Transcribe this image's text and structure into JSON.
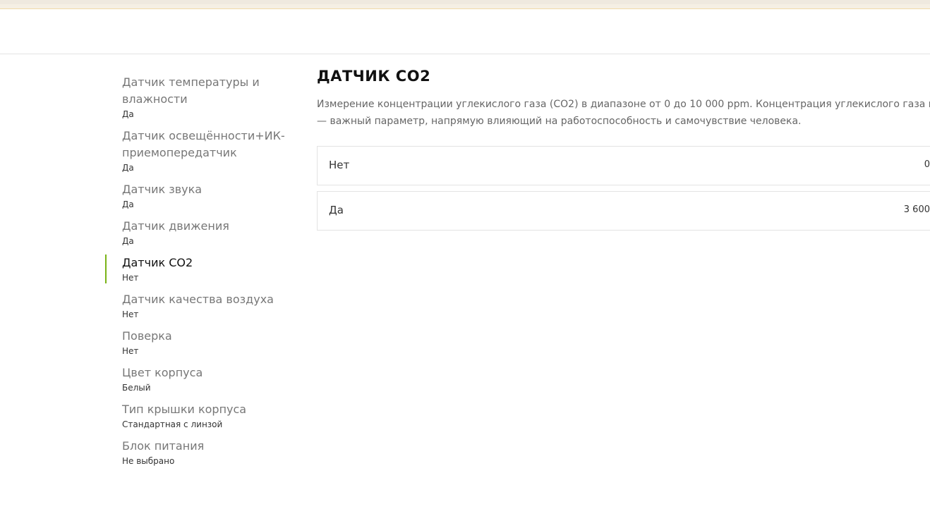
{
  "sidebar": {
    "items": [
      {
        "label": "Датчик температуры и влажности",
        "value": "Да"
      },
      {
        "label": "Датчик освещённости+ИК-приемопередатчик",
        "value": "Да"
      },
      {
        "label": "Датчик звука",
        "value": "Да"
      },
      {
        "label": "Датчик движения",
        "value": "Да"
      },
      {
        "label": "Датчик CO2",
        "value": "Нет",
        "active": true
      },
      {
        "label": "Датчик качества воздуха",
        "value": "Нет"
      },
      {
        "label": "Поверка",
        "value": "Нет"
      },
      {
        "label": "Цвет корпуса",
        "value": "Белый"
      },
      {
        "label": "Тип крышки корпуса",
        "value": "Стандартная с линзой"
      },
      {
        "label": "Блок питания",
        "value": "Не выбрано"
      }
    ]
  },
  "main": {
    "title": "ДАТЧИК CO2",
    "description_line1": "Измерение концентрации углекислого газа (CO2) в диапазоне от 0 до 10 000 ppm. Концентрация углекислого газа в помещении",
    "description_line2": "— важный параметр, напрямую влияющий на работоспособность и самочувствие человека.",
    "choices": [
      {
        "label": "Нет",
        "price": "0"
      },
      {
        "label": "Да",
        "price": "3 600"
      }
    ]
  },
  "colors": {
    "accent": "#7ab317",
    "border": "#e3e3e3",
    "top_bar": "#f5efe4"
  }
}
